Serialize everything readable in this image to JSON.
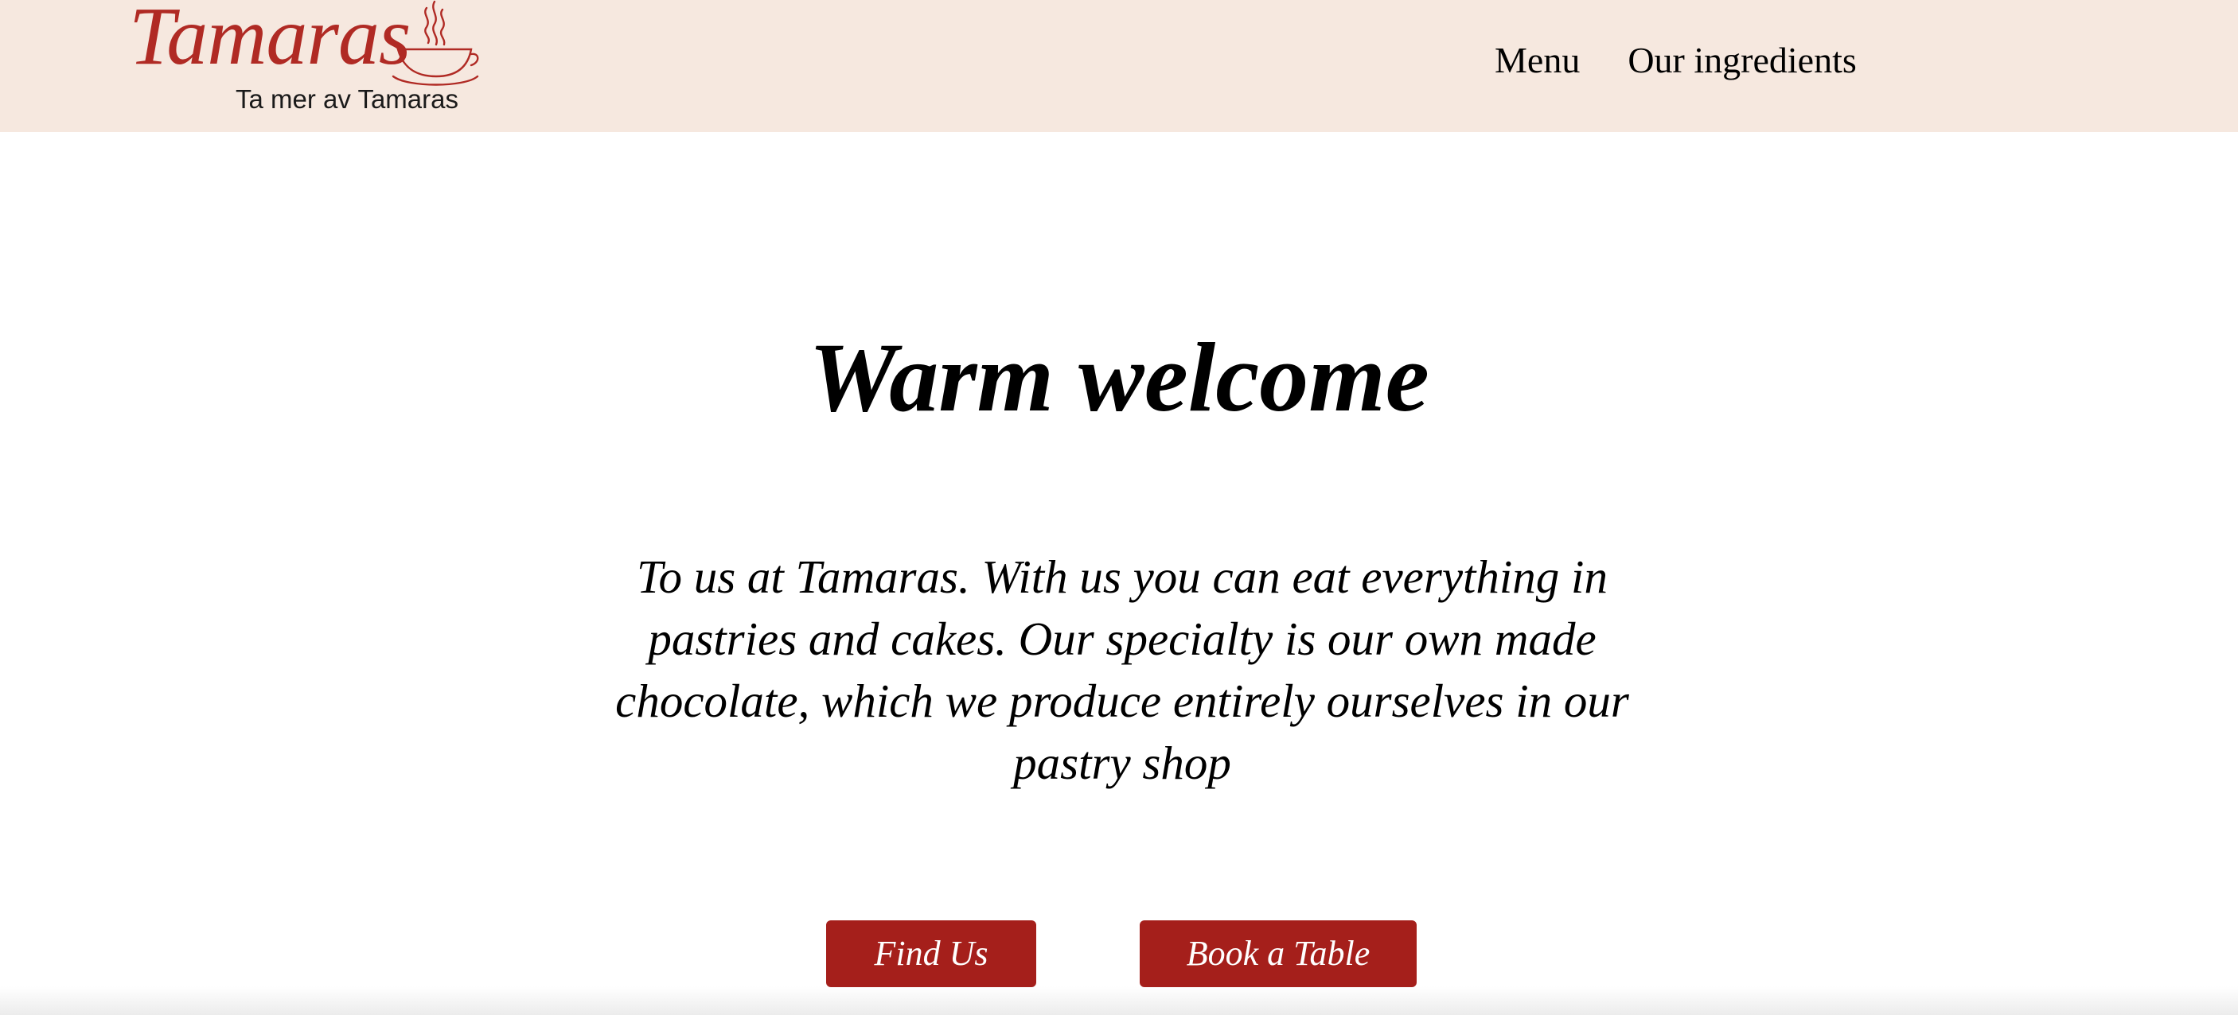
{
  "header": {
    "logo": {
      "script_text": "Tamaras",
      "tagline": "Ta mer av Tamaras"
    },
    "nav": [
      {
        "label": "Menu"
      },
      {
        "label": "Our ingredients"
      }
    ]
  },
  "hero": {
    "title": "Warm welcome",
    "text": "To us at Tamaras. With us you can eat everything in pastries and cakes. Our specialty is our own made chocolate, which we produce entirely ourselves in our pastry shop",
    "buttons": {
      "find_us": "Find Us",
      "book_table": "Book a Table"
    }
  },
  "colors": {
    "header_bg": "#f6e8df",
    "brand_red": "#b02a24",
    "button_bg": "#a51f1b",
    "button_text": "#ffffff"
  },
  "icons": {
    "logo_cup": "steaming-coffee-cup-icon"
  }
}
